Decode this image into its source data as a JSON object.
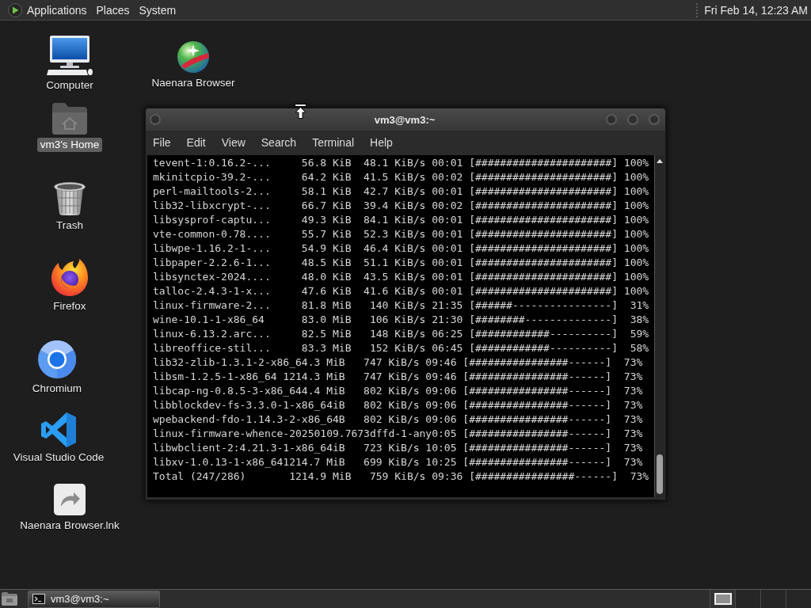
{
  "top_panel": {
    "menus": [
      "Applications",
      "Places",
      "System"
    ],
    "clock": "Fri Feb 14, 12:23 AM"
  },
  "desktop_icons": [
    {
      "kind": "computer",
      "label": "Computer",
      "selected": false
    },
    {
      "kind": "globe",
      "label": "Naenara Browser",
      "selected": false
    },
    {
      "kind": "home-folder",
      "label": "vm3's Home",
      "selected": true
    },
    {
      "kind": "trash",
      "label": "Trash",
      "selected": false
    },
    {
      "kind": "firefox",
      "label": "Firefox",
      "selected": false
    },
    {
      "kind": "chromium",
      "label": "Chromium",
      "selected": false
    },
    {
      "kind": "vscode",
      "label": "Visual Studio Code",
      "selected": false
    },
    {
      "kind": "shortcut",
      "label": "Naenara Browser.lnk",
      "selected": false
    }
  ],
  "terminal_window": {
    "title": "vm3@vm3:~",
    "menu": [
      "File",
      "Edit",
      "View",
      "Search",
      "Terminal",
      "Help"
    ],
    "lines": [
      "tevent-1:0.16.2-...     56.8 KiB  48.1 KiB/s 00:01 [######################] 100%",
      "mkinitcpio-39.2-...     64.2 KiB  41.5 KiB/s 00:02 [######################] 100%",
      "perl-mailtools-2...     58.1 KiB  42.7 KiB/s 00:01 [######################] 100%",
      "lib32-libxcrypt-...     66.7 KiB  39.4 KiB/s 00:02 [######################] 100%",
      "libsysprof-captu...     49.3 KiB  84.1 KiB/s 00:01 [######################] 100%",
      "vte-common-0.78....     55.7 KiB  52.3 KiB/s 00:01 [######################] 100%",
      "libwpe-1.16.2-1-...     54.9 KiB  46.4 KiB/s 00:01 [######################] 100%",
      "libpaper-2.2.6-1...     48.5 KiB  51.1 KiB/s 00:01 [######################] 100%",
      "libsynctex-2024....     48.0 KiB  43.5 KiB/s 00:01 [######################] 100%",
      "talloc-2.4.3-1-x...     47.6 KiB  41.6 KiB/s 00:01 [######################] 100%",
      "linux-firmware-2...     81.8 MiB   140 KiB/s 21:35 [######----------------]  31%",
      "wine-10.1-1-x86_64      83.0 MiB   106 KiB/s 21:30 [########--------------]  38%",
      "linux-6.13.2.arc...     82.5 MiB   148 KiB/s 06:25 [############----------]  59%",
      "libreoffice-stil...     83.3 MiB   152 KiB/s 06:45 [############----------]  58%",
      "lib32-zlib-1.3.1-2-x86_64.3 MiB   747 KiB/s 09:46 [################------]  73%",
      "libsm-1.2.5-1-x86_64 1214.3 MiB   747 KiB/s 09:46 [################------]  73%",
      "libcap-ng-0.8.5-3-x86_644.4 MiB   802 KiB/s 09:06 [################------]  73%",
      "libblockdev-fs-3.3.0-1-x86_64iB   802 KiB/s 09:06 [################------]  73%",
      "wpebackend-fdo-1.14.3-2-x86_64B   802 KiB/s 09:06 [################------]  73%",
      "linux-firmware-whence-20250109.7673dffd-1-any0:05 [################------]  73%",
      "libwbclient-2:4.21.3-1-x86_64iB   723 KiB/s 10:05 [################------]  73%",
      "libxv-1.0.13-1-x86_641214.7 MiB   699 KiB/s 10:25 [################------]  73%",
      "Total (247/286)       1214.9 MiB   759 KiB/s 09:36 [################------]  73%"
    ]
  },
  "bottom_panel": {
    "tasks": [
      {
        "label": "vm3@vm3:~",
        "selected": true
      }
    ],
    "workspaces": [
      {
        "selected": true,
        "has_window": true
      },
      {
        "selected": false,
        "has_window": false
      },
      {
        "selected": false,
        "has_window": false
      },
      {
        "selected": false,
        "has_window": false
      }
    ]
  }
}
